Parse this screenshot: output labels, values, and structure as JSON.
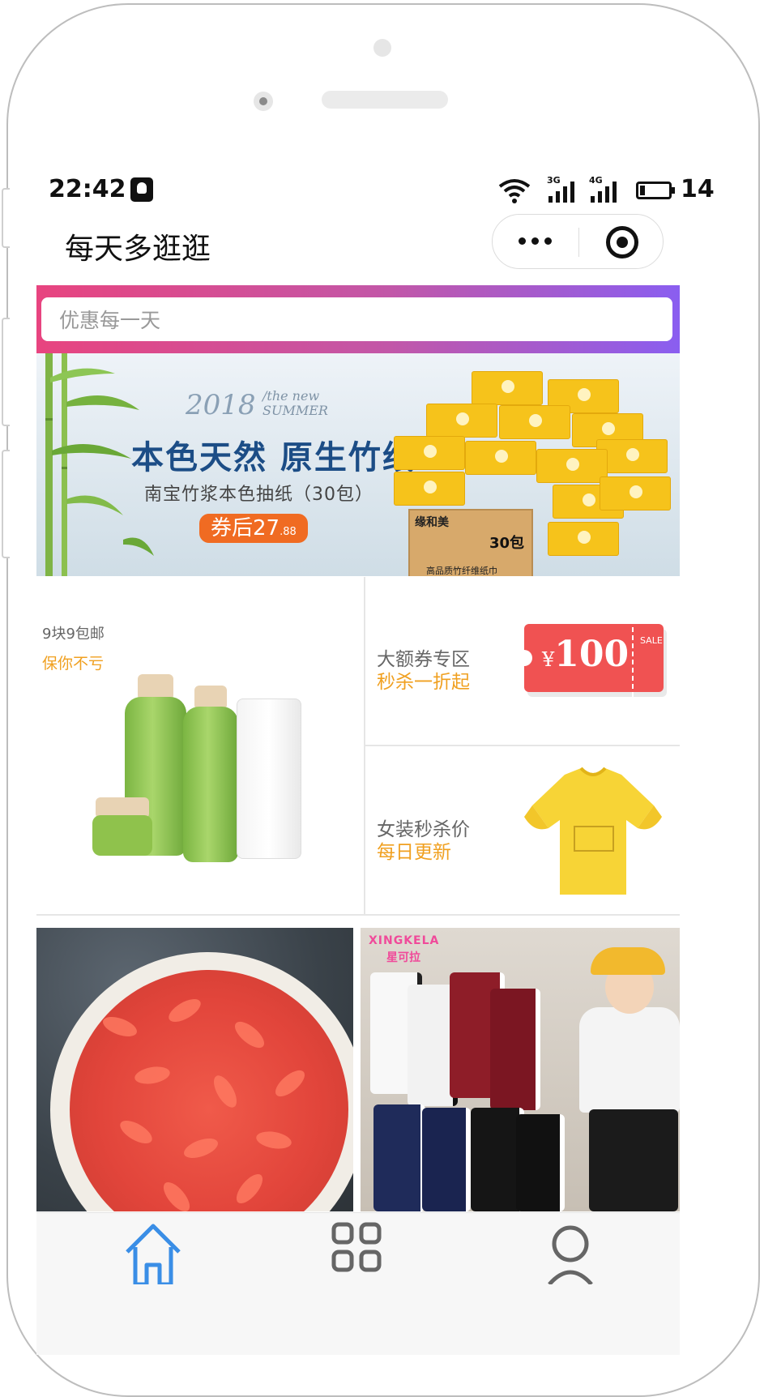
{
  "status_bar": {
    "time": "22:42",
    "network_1": "3G",
    "network_2": "4G",
    "battery": "14"
  },
  "navbar": {
    "title": "每天多逛逛",
    "more_icon": "more-icon",
    "scan_icon": "target-icon"
  },
  "search": {
    "placeholder": "优惠每一天"
  },
  "banner": {
    "year": "2018",
    "season_line1": "/the new",
    "season_line2": "SUMMER",
    "headline": "本色天然 原生竹纸",
    "subline": "南宝竹浆本色抽纸（30包）",
    "price_prefix": "券后27",
    "price_decimal": ".88",
    "box_brand": "缘和美",
    "box_count": "30包",
    "box_note": "高品质竹纤维纸巾"
  },
  "promos": [
    {
      "title": "9块9包邮",
      "subtitle": "保你不亏"
    },
    {
      "title": "大额券专区",
      "subtitle": "秒杀一折起",
      "ticket_symbol": "¥",
      "ticket_value": "100",
      "ticket_tag": "SALE"
    },
    {
      "title": "女装秒杀价",
      "subtitle": "每日更新"
    }
  ],
  "products": [
    {
      "name": "goji-berries",
      "brand": ""
    },
    {
      "name": "kids-pants",
      "brand": "XINGKELA",
      "brand_cn": "星可拉"
    }
  ],
  "tabbar": {
    "items": [
      "home-icon",
      "category-icon",
      "user-icon"
    ]
  },
  "colors": {
    "accent_orange": "#f0a020",
    "search_gradient_start": "#e8447f",
    "search_gradient_end": "#8a5ef0",
    "ticket_red": "#f05252",
    "tab_active": "#3a8ee6"
  }
}
